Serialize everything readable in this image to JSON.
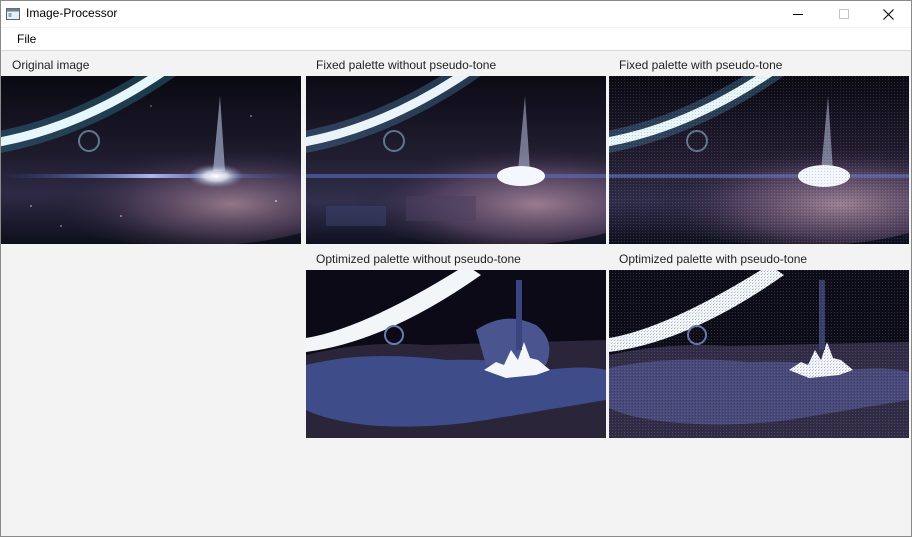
{
  "window": {
    "title": "Image-Processor",
    "icons": [
      "app-window-icon",
      "minimize-icon",
      "maximize-icon",
      "close-icon"
    ]
  },
  "menu": {
    "file_label": "File"
  },
  "panels": {
    "original": {
      "label": "Original image"
    },
    "fixed_no_pseudo": {
      "label": "Fixed palette without pseudo-tone"
    },
    "fixed_pseudo": {
      "label": "Fixed palette with pseudo-tone"
    },
    "optimized_no_pseudo": {
      "label": "Optimized palette without pseudo-tone"
    },
    "optimized_pseudo": {
      "label": "Optimized palette with pseudo-tone"
    }
  },
  "colors": {
    "window_bg": "#f3f3f3",
    "space_dark": "#0b0a14",
    "nebula_purple": "#6b5a74",
    "nebula_blue": "#3b4c8e",
    "ring_glow": "#dbeff4"
  }
}
